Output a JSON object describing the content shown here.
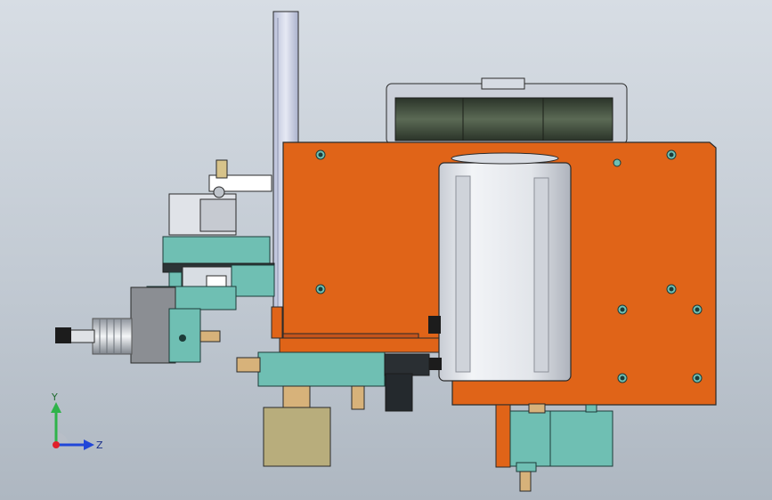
{
  "viewport": {
    "background_top": "#d7dde4",
    "background_bottom": "#aeb7c1"
  },
  "colors": {
    "plate_orange": "#e06418",
    "plate_orange_dark": "#c5541a",
    "teal": "#6fbfb3",
    "motor_grey": "#e6e9ee",
    "khaki": "#b8ad7c",
    "fan_dark": "#3e4a3a",
    "outline": "#2a2a2a"
  },
  "triad": {
    "y_label": "Y",
    "z_label": "Z",
    "y_color": "#2fb34a",
    "z_color": "#2046d8",
    "origin_color": "#e0202a"
  },
  "icons": {
    "triad": "view-orientation-triad-icon"
  }
}
